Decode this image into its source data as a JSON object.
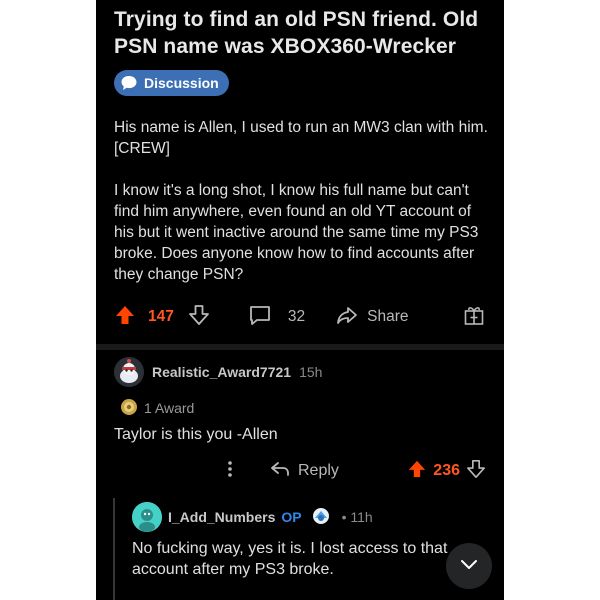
{
  "post": {
    "title": "Trying to find an old PSN friend. Old PSN name was XBOX360-Wrecker",
    "flair": "Discussion",
    "body": [
      "His name is Allen, I used to run an MW3 clan with him. [CREW]",
      "I know it's a long shot, I know his full name but can't find him anywhere, even found an old YT account of his but it went inactive around the same time my PS3 broke. Does anyone know how to find accounts after they change PSN?"
    ],
    "upvotes": "147",
    "comments": "32",
    "share_label": "Share"
  },
  "comment": {
    "username": "Realistic_Award7721",
    "time": "15h",
    "award": "1 Award",
    "text": "Taylor is this you -Allen",
    "reply_label": "Reply",
    "upvotes": "236"
  },
  "reply": {
    "username": "I_Add_Numbers",
    "op_tag": "OP",
    "time": "• 11h",
    "text": "No fucking way, yes it is. I lost access to that account after my PS3 broke."
  },
  "colors": {
    "background": "#000000",
    "upvote_accent": "#ff5722",
    "flair_bg": "#3c6fb4",
    "op_tag": "#2f87e8"
  },
  "icons": [
    "upvote-arrow-icon",
    "downvote-arrow-icon",
    "comment-bubble-icon",
    "share-arrow-icon",
    "award-gift-icon",
    "more-dots-icon",
    "reply-arrow-icon",
    "chevron-down-icon"
  ]
}
